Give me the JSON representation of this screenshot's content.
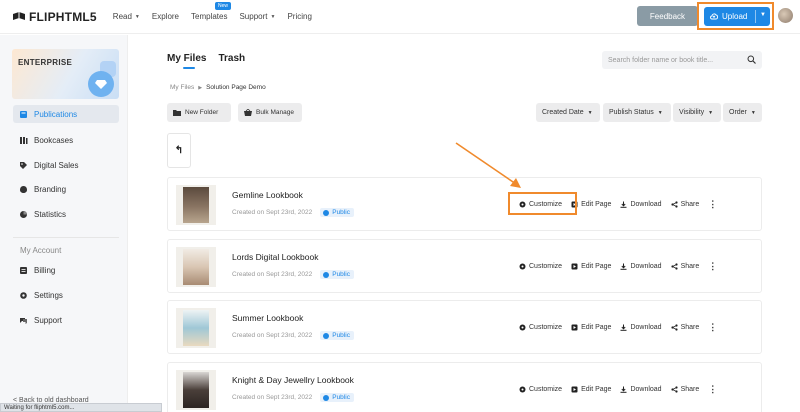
{
  "brand": {
    "name": "FLIPHTML5"
  },
  "nav": {
    "links": [
      {
        "label": "Read",
        "caret": true
      },
      {
        "label": "Explore",
        "caret": false
      },
      {
        "label": "Templates",
        "caret": false,
        "badge": "New"
      },
      {
        "label": "Support",
        "caret": true
      },
      {
        "label": "Pricing",
        "caret": false
      }
    ],
    "feedback": "Feedback",
    "upload": "Upload"
  },
  "sidebar": {
    "plan": "ENTERPRISE",
    "items": [
      {
        "label": "Publications",
        "icon": "publications-icon",
        "active": true
      },
      {
        "label": "Bookcases",
        "icon": "bookcases-icon"
      },
      {
        "label": "Digital Sales",
        "icon": "tag-icon"
      },
      {
        "label": "Branding",
        "icon": "branding-icon"
      },
      {
        "label": "Statistics",
        "icon": "pie-chart-icon"
      }
    ],
    "account_heading": "My Account",
    "account_items": [
      {
        "label": "Billing",
        "icon": "billing-icon"
      },
      {
        "label": "Settings",
        "icon": "gear-icon"
      },
      {
        "label": "Support",
        "icon": "chat-icon"
      }
    ],
    "back_link": "< Back to old dashboard"
  },
  "status_bar": "Waiting for fliphtml5.com...",
  "main": {
    "tabs": [
      "My Files",
      "Trash"
    ],
    "search_placeholder": "Search folder name or book title...",
    "breadcrumb": {
      "root": "My Files",
      "current": "Solution Page Demo"
    },
    "new_folder": "New Folder",
    "bulk_manage": "Bulk Manage",
    "filters": [
      "Created Date",
      "Publish Status",
      "Visibility",
      "Order"
    ],
    "back_symbol": "↰",
    "rows": [
      {
        "title": "Gemline Lookbook",
        "created": "Created on Sept 23rd, 2022",
        "status": "Public"
      },
      {
        "title": "Lords Digital Lookbook",
        "created": "Created on Sept 23rd, 2022",
        "status": "Public"
      },
      {
        "title": "Summer Lookbook",
        "created": "Created on Sept 23rd, 2022",
        "status": "Public"
      },
      {
        "title": "Knight & Day Jewellry Lookbook",
        "created": "Created on Sept 23rd, 2022",
        "status": "Public"
      }
    ],
    "actions": {
      "customize": "Customize",
      "edit": "Edit Page",
      "download": "Download",
      "share": "Share",
      "more": "⋮"
    }
  },
  "colors": {
    "accent": "#1e88e5",
    "highlight": "#f08a2c",
    "feedback": "#8a9ba5"
  }
}
